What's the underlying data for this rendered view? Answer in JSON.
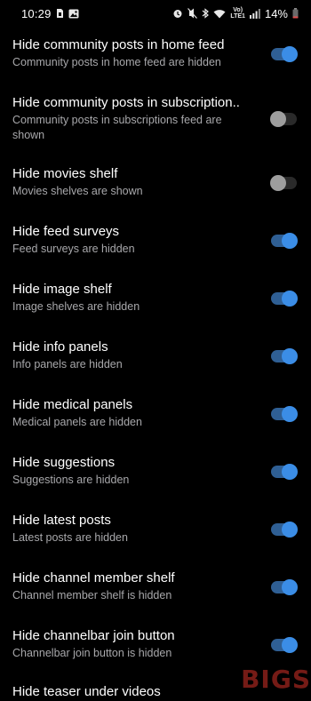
{
  "status_bar": {
    "time": "10:29",
    "battery": "14%",
    "network_label_top": "Vo)",
    "network_label_bottom": "LTE1",
    "icons": [
      "sim-icon",
      "gallery-icon",
      "alarm-icon",
      "mute-icon",
      "bluetooth-icon",
      "wifi-icon",
      "signal-icon",
      "battery-icon"
    ]
  },
  "settings": [
    {
      "title": "Hide community posts in home feed",
      "summary": "Community posts in home feed are hidden",
      "enabled": true
    },
    {
      "title": "Hide community posts in subscription..",
      "summary": "Community posts in subscriptions feed are shown",
      "enabled": false
    },
    {
      "title": "Hide movies shelf",
      "summary": "Movies shelves are shown",
      "enabled": false
    },
    {
      "title": "Hide feed surveys",
      "summary": "Feed surveys are hidden",
      "enabled": true
    },
    {
      "title": "Hide image shelf",
      "summary": "Image shelves are hidden",
      "enabled": true
    },
    {
      "title": "Hide info panels",
      "summary": "Info panels are hidden",
      "enabled": true
    },
    {
      "title": "Hide medical panels",
      "summary": "Medical panels are hidden",
      "enabled": true
    },
    {
      "title": "Hide suggestions",
      "summary": "Suggestions are hidden",
      "enabled": true
    },
    {
      "title": "Hide latest posts",
      "summary": "Latest posts are hidden",
      "enabled": true
    },
    {
      "title": "Hide channel member shelf",
      "summary": "Channel member shelf is hidden",
      "enabled": true
    },
    {
      "title": "Hide channelbar join button",
      "summary": "Channelbar join button is hidden",
      "enabled": true
    }
  ],
  "partial_row_title": "Hide teaser under videos",
  "watermark": "BIGS",
  "colors": {
    "background": "#000000",
    "toggle_on_knob": "#3b8de6",
    "toggle_on_track": "#2f5f94",
    "toggle_off_knob": "#9e9e9e",
    "toggle_off_track": "#2a2a2a",
    "summary_text": "#a8a8ab"
  }
}
